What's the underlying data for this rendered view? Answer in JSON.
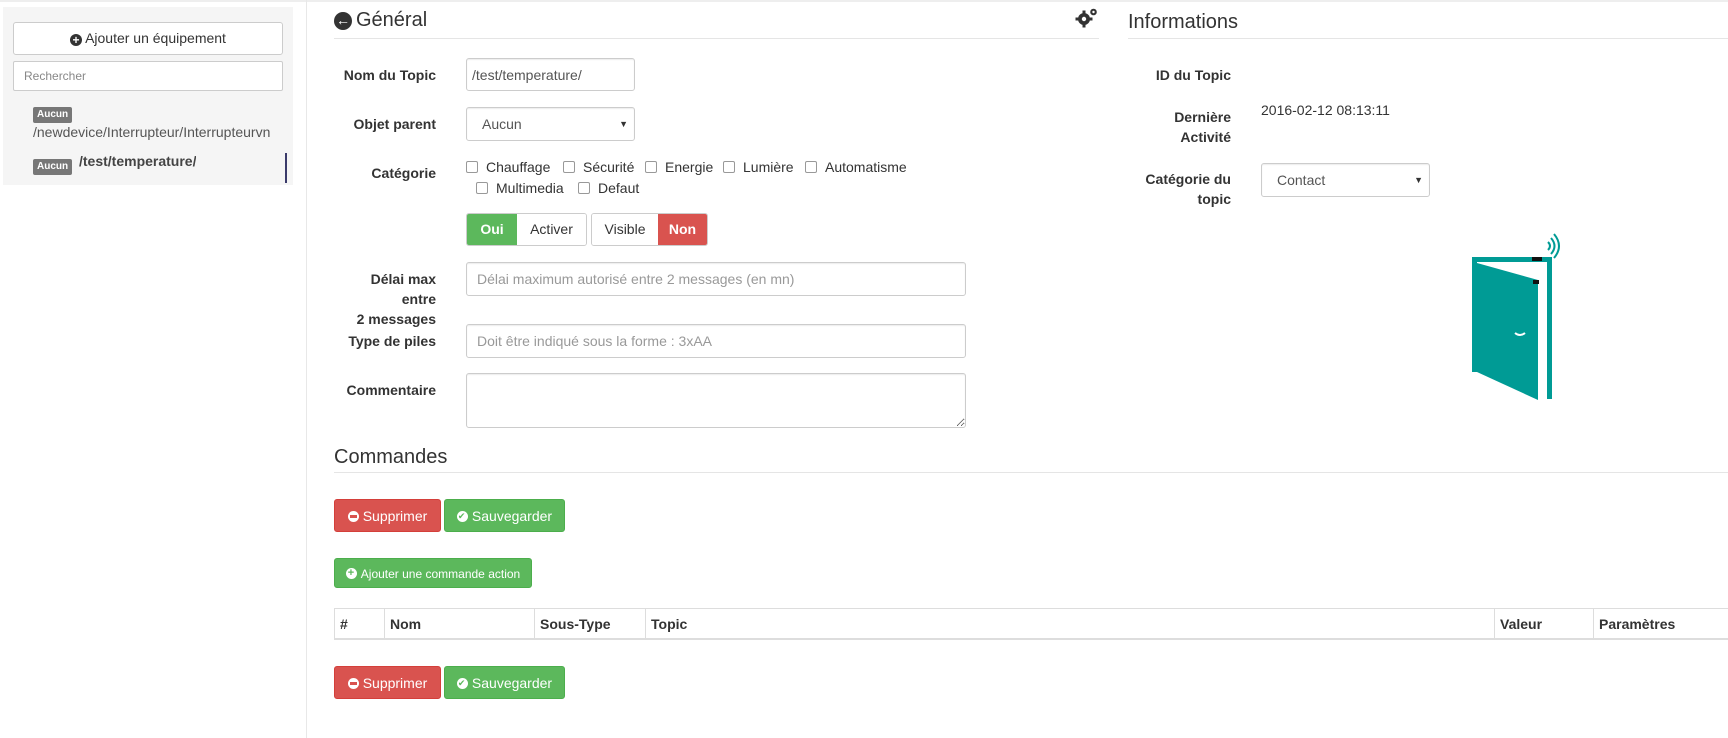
{
  "sidebar": {
    "add_button": "Ajouter un équipement",
    "search_placeholder": "Rechercher",
    "items": [
      {
        "badge": "Aucun",
        "path": "/newdevice/Interrupteur/Interrupteurvn"
      },
      {
        "badge": "Aucun",
        "path": "/test/temperature/"
      }
    ]
  },
  "general": {
    "title": "Général",
    "labels": {
      "topic_name": "Nom du Topic",
      "parent": "Objet parent",
      "category": "Catégorie",
      "max_delay_1": "Délai max entre",
      "max_delay_2": "2 messages",
      "battery": "Type de piles",
      "comment": "Commentaire"
    },
    "topic_name_value": "/test/temperature/",
    "parent_value": "Aucun",
    "categories": [
      "Chauffage",
      "Sécurité",
      "Energie",
      "Lumière",
      "Automatisme",
      "Multimedia",
      "Defaut"
    ],
    "toggle_enable": {
      "on": "Oui",
      "label": "Activer"
    },
    "toggle_visible": {
      "label": "Visible",
      "off": "Non"
    },
    "max_delay_placeholder": "Délai maximum autorisé entre 2 messages (en mn)",
    "battery_placeholder": "Doit être indiqué sous la forme : 3xAA",
    "comment_value": ""
  },
  "info": {
    "title": "Informations",
    "labels": {
      "topic_id": "ID du Topic",
      "last_activity_1": "Dernière",
      "last_activity_2": "Activité",
      "topic_category_1": "Catégorie du",
      "topic_category_2": "topic"
    },
    "topic_id_value": "",
    "last_activity_value": "2016-02-12 08:13:11",
    "topic_category_value": "Contact"
  },
  "commands": {
    "title": "Commandes",
    "delete_label": "Supprimer",
    "save_label": "Sauvegarder",
    "add_action_label": "Ajouter une commande action",
    "table_headers": [
      "#",
      "Nom",
      "Sous-Type",
      "Topic",
      "Valeur",
      "Paramètres"
    ]
  },
  "colors": {
    "success": "#5cb85c",
    "danger": "#d9534f",
    "badge": "#777777",
    "door": "#009b95"
  },
  "icons": [
    "plus-circle-icon",
    "arrow-circle-left-icon",
    "gears-icon",
    "minus-circle-icon",
    "check-circle-icon",
    "door-open-icon"
  ]
}
